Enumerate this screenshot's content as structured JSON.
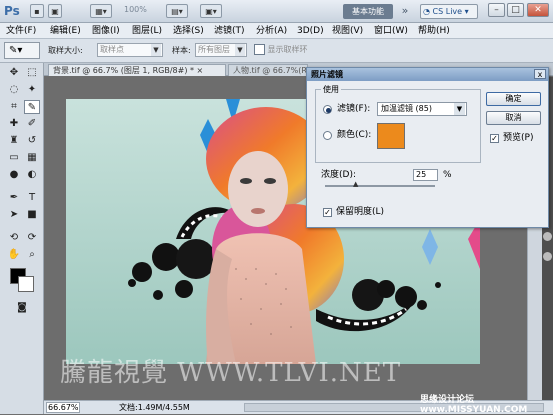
{
  "titlebar": {
    "logo": "Ps",
    "zoom_display": "100%",
    "workspace": "基本功能",
    "chevron": "»",
    "cs_live": "CS Live",
    "minimize": "–",
    "maximize": "□",
    "close": "✕"
  },
  "menus": [
    "文件(F)",
    "编辑(E)",
    "图像(I)",
    "图层(L)",
    "选择(S)",
    "滤镜(T)",
    "分析(A)",
    "3D(D)",
    "视图(V)",
    "窗口(W)",
    "帮助(H)"
  ],
  "options_bar": {
    "sample_size_label": "取样大小:",
    "sample_size_value": "取样点",
    "sample_label": "样本:",
    "sample_value": "所有图层",
    "show_ring": "显示取样环"
  },
  "tabs": [
    {
      "label": "背景.tif @ 66.7% (图层 1, RGB/8#) *"
    },
    {
      "label": "人物.tif @ 66.7%(RGB/8#)"
    }
  ],
  "dialog": {
    "title": "照片滤镜",
    "use_label": "使用",
    "filter_label": "滤镜(F):",
    "filter_value": "加温滤镜 (85)",
    "color_label": "颜色(C):",
    "color_swatch": "#ec8a1c",
    "ok": "确定",
    "cancel": "取消",
    "preview": "预览(P)",
    "density_label": "浓度(D):",
    "density_value": "25",
    "density_unit": "%",
    "preserve": "保留明度(L)",
    "close": "x"
  },
  "status": {
    "zoom": "66.67%",
    "doc_info": "文档:1.49M/4.55M"
  },
  "watermarks": {
    "tlvi": "騰龍視覺 WWW.TLVI.NET",
    "missyuan": "思缘设计论坛 www.MISSYUAN.COM"
  },
  "colors": {
    "accent": "#7d9dc4",
    "swatch": "#ec8a1c",
    "canvas_bg": "#a9cfc6"
  }
}
